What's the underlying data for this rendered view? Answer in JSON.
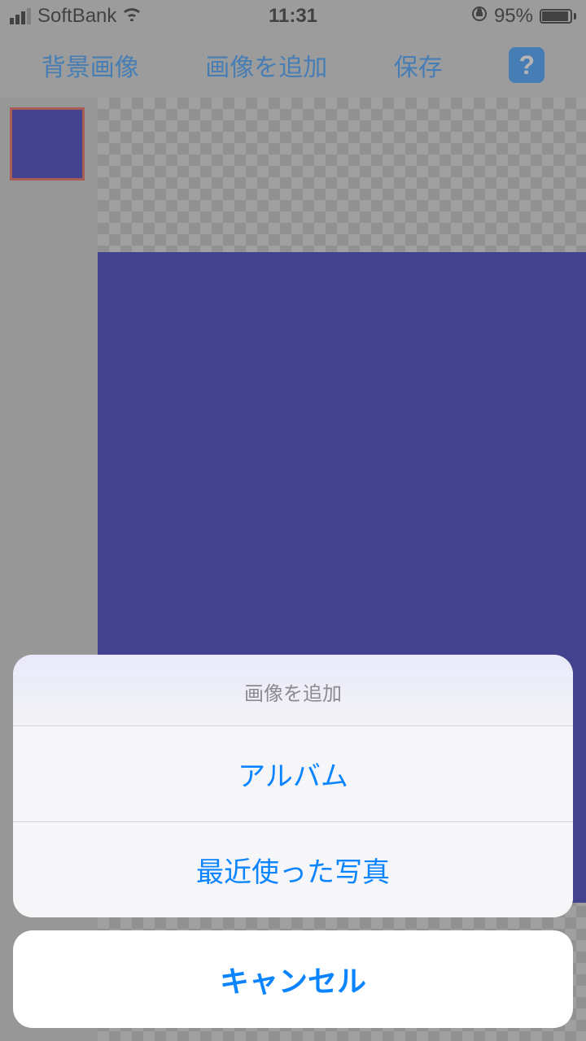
{
  "status": {
    "carrier": "SoftBank",
    "time": "11:31",
    "battery_pct": "95%"
  },
  "toolbar": {
    "background_image": "背景画像",
    "add_image": "画像を追加",
    "save": "保存",
    "help": "?"
  },
  "actionsheet": {
    "title": "画像を追加",
    "album": "アルバム",
    "recent": "最近使った写真",
    "cancel": "キャンセル"
  }
}
